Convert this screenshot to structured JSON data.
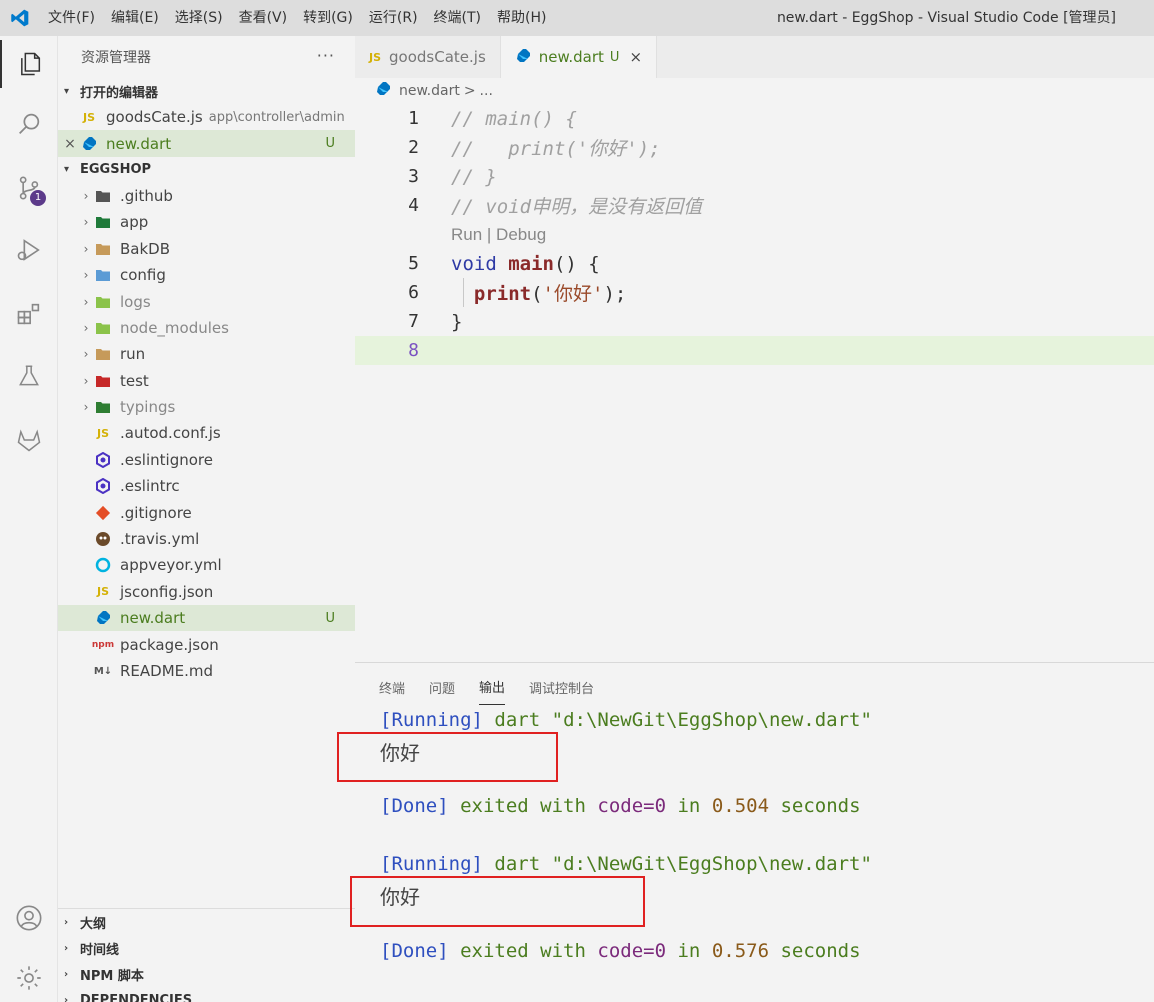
{
  "window": {
    "title": "new.dart - EggShop - Visual Studio Code [管理员]",
    "menu": [
      "文件(F)",
      "编辑(E)",
      "选择(S)",
      "查看(V)",
      "转到(G)",
      "运行(R)",
      "终端(T)",
      "帮助(H)"
    ]
  },
  "activity_bar": {
    "items": [
      "explorer-icon",
      "search-icon",
      "source-control-icon",
      "run-debug-icon",
      "extensions-icon",
      "testing-icon",
      "gitlab-icon"
    ],
    "scm_badge": "1",
    "bottom": [
      "accounts-icon",
      "settings-gear-icon"
    ]
  },
  "sidebar": {
    "title": "资源管理器",
    "more": "···",
    "open_editors": {
      "label": "打开的编辑器",
      "items": [
        {
          "icon": "JS",
          "name": "goodsCate.js",
          "path": "app\\controller\\admin",
          "status": ""
        },
        {
          "icon": "dart",
          "name": "new.dart",
          "path": "",
          "status": "U"
        }
      ]
    },
    "project": {
      "label": "EGGSHOP",
      "items": [
        {
          "name": ".github",
          "folder": true,
          "icon_color": "#555555"
        },
        {
          "name": "app",
          "folder": true,
          "icon_color": "#1f7a3a"
        },
        {
          "name": "BakDB",
          "folder": true,
          "icon_color": "#c69a5a"
        },
        {
          "name": "config",
          "folder": true,
          "icon_color": "#5b9bd5"
        },
        {
          "name": "logs",
          "folder": true,
          "icon_color": "#8bc34a"
        },
        {
          "name": "node_modules",
          "folder": true,
          "icon_color": "#8bc34a"
        },
        {
          "name": "run",
          "folder": true,
          "icon_color": "#c69a5a"
        },
        {
          "name": "test",
          "folder": true,
          "icon_color": "#c62828"
        },
        {
          "name": "typings",
          "folder": true,
          "icon_color": "#2e7d32"
        },
        {
          "name": ".autod.conf.js",
          "folder": false,
          "icon": "JS",
          "icon_color": "#d4b106"
        },
        {
          "name": ".eslintignore",
          "folder": false,
          "icon": "eslint",
          "icon_color": "#4b32c3"
        },
        {
          "name": ".eslintrc",
          "folder": false,
          "icon": "eslint",
          "icon_color": "#4b32c3"
        },
        {
          "name": ".gitignore",
          "folder": false,
          "icon": "git",
          "icon_color": "#e44d26"
        },
        {
          "name": ".travis.yml",
          "folder": false,
          "icon": "travis",
          "icon_color": "#6b4a2a"
        },
        {
          "name": "appveyor.yml",
          "folder": false,
          "icon": "appveyor",
          "icon_color": "#00b3e0"
        },
        {
          "name": "jsconfig.json",
          "folder": false,
          "icon": "JS",
          "icon_color": "#d4b106"
        },
        {
          "name": "new.dart",
          "folder": false,
          "icon": "dart",
          "icon_color": "#0175c2",
          "status": "U"
        },
        {
          "name": "package.json",
          "folder": false,
          "icon": "npm",
          "icon_color": "#cb3837"
        },
        {
          "name": "README.md",
          "folder": false,
          "icon": "M↓",
          "icon_color": "#555555"
        }
      ]
    },
    "bottom_sections": [
      "大纲",
      "时间线",
      "NPM 脚本",
      "DEPENDENCIES"
    ]
  },
  "editor": {
    "tabs": [
      {
        "icon": "JS",
        "label": "goodsCate.js",
        "status": ""
      },
      {
        "icon": "dart",
        "label": "new.dart",
        "status": "U",
        "close": "×"
      }
    ],
    "breadcrumb": [
      "new.dart",
      ">",
      "..."
    ],
    "code_lens": "Run | Debug",
    "lines": [
      {
        "n": "1",
        "text": "// main() {"
      },
      {
        "n": "2",
        "text": "//   print('你好');"
      },
      {
        "n": "3",
        "text": "// }"
      },
      {
        "n": "4",
        "text": "// void申明，是没有返回值"
      },
      {
        "n": "5",
        "text": "void main() {"
      },
      {
        "n": "6",
        "text": "  print('你好');"
      },
      {
        "n": "7",
        "text": "}"
      },
      {
        "n": "8",
        "text": ""
      }
    ],
    "tokens": {
      "void": "void",
      "main": "main",
      "paren_open": "() {",
      "print": "print",
      "lp": "(",
      "str": "'你好'",
      "rp": ");",
      "close_brace": "}"
    }
  },
  "panel": {
    "tabs": [
      "终端",
      "问题",
      "输出",
      "调试控制台"
    ],
    "active_tab": "输出",
    "runs": [
      {
        "running": "[Running]",
        "cmd": "dart",
        "path": "\"d:\\NewGit\\EggShop\\new.dart\"",
        "output": "你好",
        "done": "[Done]",
        "exited": "exited with",
        "code": "code=0",
        "in": "in",
        "time": "0.504",
        "seconds": "seconds"
      },
      {
        "running": "[Running]",
        "cmd": "dart",
        "path": "\"d:\\NewGit\\EggShop\\new.dart\"",
        "output": "你好",
        "done": "[Done]",
        "exited": "exited with",
        "code": "code=0",
        "in": "in",
        "time": "0.576",
        "seconds": "seconds"
      }
    ]
  },
  "colors": {
    "accent_vscode": "#007acc",
    "git_untracked": "#4b7d1f",
    "annotation_box": "#e02020"
  }
}
